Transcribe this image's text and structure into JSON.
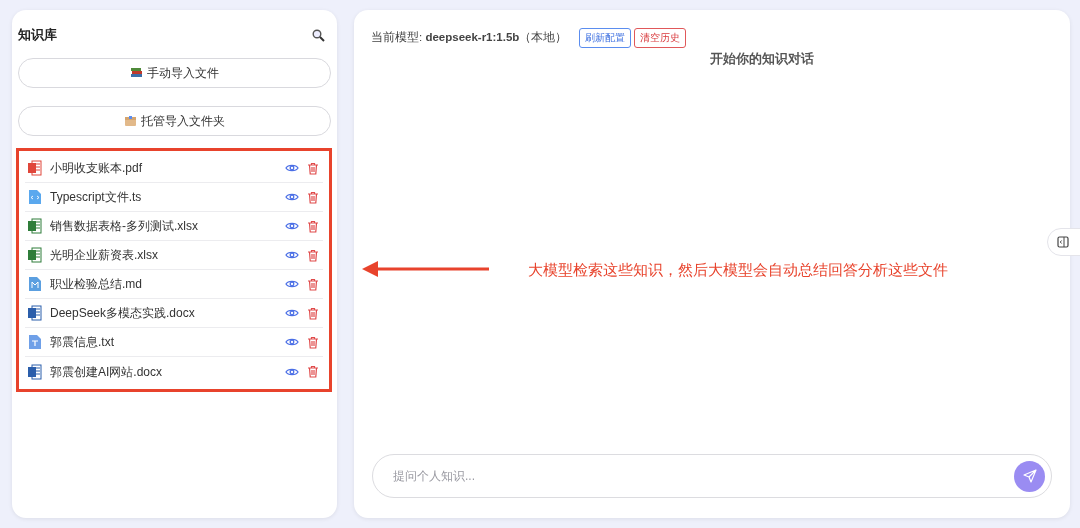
{
  "sidebar": {
    "title": "知识库",
    "buttons": [
      {
        "label": "手动导入文件",
        "kind": "books"
      },
      {
        "label": "托管导入文件夹",
        "kind": "box"
      }
    ],
    "files": [
      {
        "name": "小明收支账本.pdf",
        "kind": "pdf"
      },
      {
        "name": "Typescript文件.ts",
        "kind": "code"
      },
      {
        "name": "销售数据表格-多列测试.xlsx",
        "kind": "excel"
      },
      {
        "name": "光明企业薪资表.xlsx",
        "kind": "excel"
      },
      {
        "name": "职业检验总结.md",
        "kind": "md"
      },
      {
        "name": "DeepSeek多模态实践.docx",
        "kind": "word"
      },
      {
        "name": "郭震信息.txt",
        "kind": "txt"
      },
      {
        "name": "郭震创建AI网站.docx",
        "kind": "word"
      }
    ]
  },
  "chat": {
    "model_label": "当前模型: ",
    "model_name": "deepseek-r1:1.5b",
    "model_suffix": "（本地）",
    "buttons": [
      {
        "label": "刷新配置",
        "kind": "primary"
      },
      {
        "label": "清空历史",
        "kind": "danger"
      }
    ],
    "heading": "开始你的知识对话",
    "input": {
      "placeholder": "提问个人知识..."
    }
  },
  "annotation": {
    "text": "大模型检索这些知识，然后大模型会自动总结回答分析这些文件"
  }
}
